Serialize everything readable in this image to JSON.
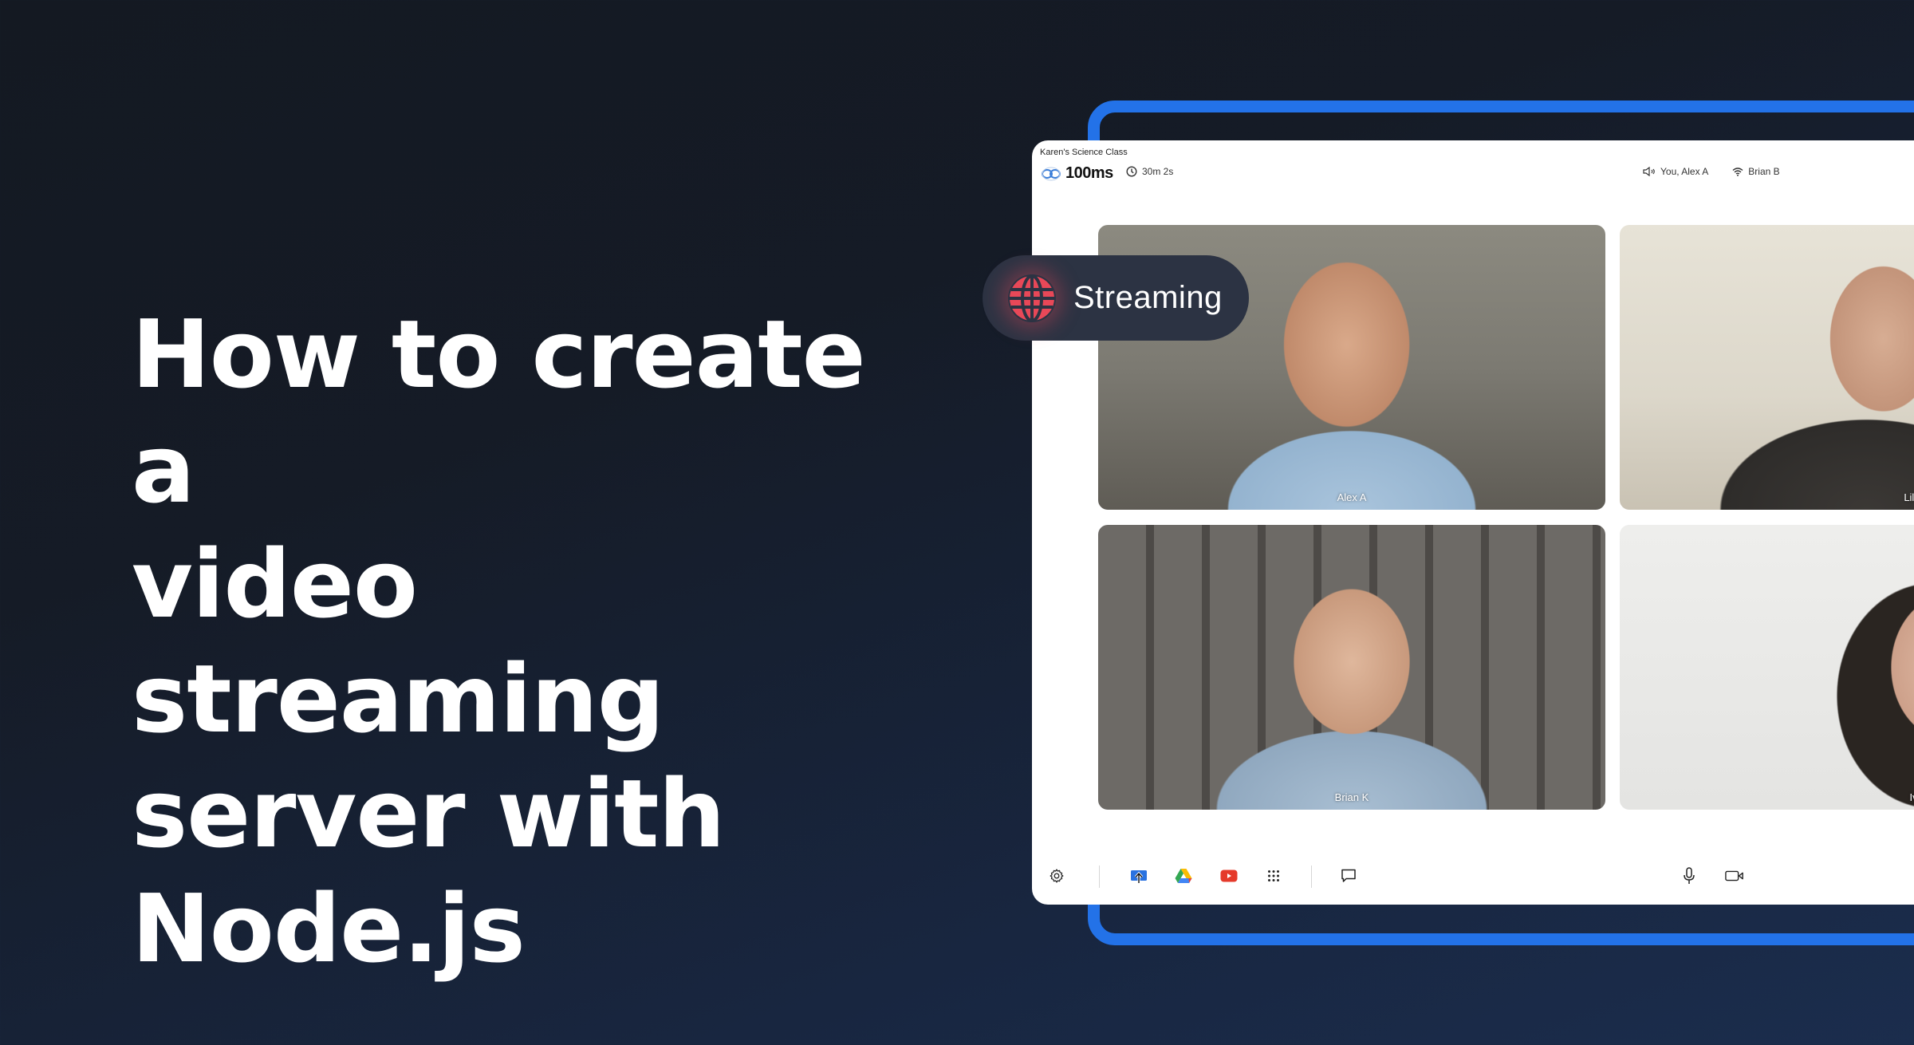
{
  "headline": {
    "lines": [
      "How to create a",
      "video streaming",
      "server with",
      "Node.js"
    ]
  },
  "app": {
    "room_name": "Karen's Science Class",
    "brand_name": "100ms",
    "duration": "30m 2s",
    "speaking": "You, Alex A",
    "network": "Brian B"
  },
  "streaming_badge": {
    "label": "Streaming",
    "icon": "globe-icon",
    "color": "#e84858"
  },
  "tiles": [
    {
      "name": "Alex A"
    },
    {
      "name": "Lilly B"
    },
    {
      "name": "Brian K"
    },
    {
      "name": "Ivy L"
    }
  ],
  "toolbar": {
    "left": [
      {
        "icon": "gear-icon",
        "label": "Settings"
      },
      {
        "icon": "screen-share-icon",
        "label": "Share screen"
      },
      {
        "icon": "google-drive-icon",
        "label": "Google Drive"
      },
      {
        "icon": "youtube-icon",
        "label": "YouTube"
      },
      {
        "icon": "apps-grid-icon",
        "label": "More apps"
      },
      {
        "icon": "chat-icon",
        "label": "Chat"
      }
    ],
    "right": [
      {
        "icon": "microphone-icon",
        "label": "Microphone"
      },
      {
        "icon": "camera-icon",
        "label": "Camera"
      }
    ]
  },
  "colors": {
    "accent_blue": "#2372e8",
    "pill_bg": "#2c3343",
    "background_dark": "#141922",
    "background_navy": "#1b2d4d"
  }
}
